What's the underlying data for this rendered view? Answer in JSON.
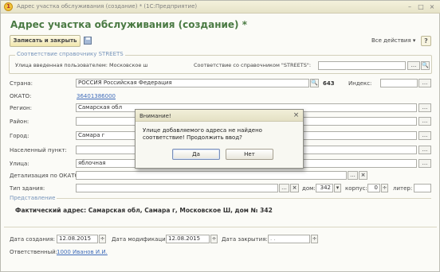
{
  "window": {
    "title": "Адрес участка обслуживания (создание) * (1С:Предприятие)",
    "app_icon": "1c-logo-icon",
    "controls": [
      "minimize-icon",
      "maximize-icon",
      "close-icon"
    ],
    "controls_glyphs": {
      "min": "–",
      "max": "□",
      "close": "×"
    }
  },
  "form": {
    "title": "Адрес участка обслуживания (создание) *",
    "title_color": "#3b6f33",
    "toolbar": {
      "save_close_label": "Записать и закрыть",
      "all_actions_label": "Все действия ▾",
      "help_label": "?"
    }
  },
  "streets_group": {
    "caption": "Соответствие справочнику STREETS",
    "user_street_label": "Улица введенная пользователем: Московское ш",
    "match_label": "Соответствие со справочником \"STREETS\":",
    "match_value": "",
    "select_glyph": "..."
  },
  "fields": {
    "country": {
      "label": "Страна:",
      "value": "РОССИЯ Российская Федерация",
      "code": "643"
    },
    "index": {
      "label": "Индекс:",
      "value": ""
    },
    "okato": {
      "label": "ОКАТО:",
      "value": "36401386000"
    },
    "region": {
      "label": "Регион:",
      "value": "Самарская обл"
    },
    "district": {
      "label": "Район:",
      "value": ""
    },
    "city": {
      "label": "Город:",
      "value": "Самара г"
    },
    "locality": {
      "label": "Населенный пункт:",
      "value": ""
    },
    "street": {
      "label": "Улица:",
      "value": "яблочная"
    },
    "okato_detail": {
      "label": "Детализация по ОКАТО:",
      "value": ""
    },
    "building_type": {
      "label": "Тип здания:",
      "value": ""
    },
    "house": {
      "label": "дом:",
      "value": "342"
    },
    "corpus": {
      "label": "корпус:",
      "value": "0"
    },
    "liter": {
      "label": "литер:",
      "value": ""
    }
  },
  "buttons": {
    "select": "...",
    "clear": "×",
    "search": "🔍",
    "dropdown": "▾",
    "spin": "÷"
  },
  "representation": {
    "caption": "Представление",
    "text": "Фактический адрес: Самарская обл, Самара г, Московское Ш, дом № 342"
  },
  "footer": {
    "created_label": "Дата создания:",
    "created_value": "12.08.2015",
    "modified_label": "Дата модификации:",
    "modified_value": "12.08.2015",
    "closed_label": "Дата закрытия:",
    "closed_value": ". .",
    "responsible_label": "Ответственный:",
    "responsible_value": "1000 Иванов И.И."
  },
  "dialog": {
    "title": "Внимание!",
    "message": "Улице добавляемого адреса не найдено соответствие! Продолжить ввод?",
    "yes_label": "Да",
    "no_label": "Нет",
    "close_glyph": "×"
  }
}
